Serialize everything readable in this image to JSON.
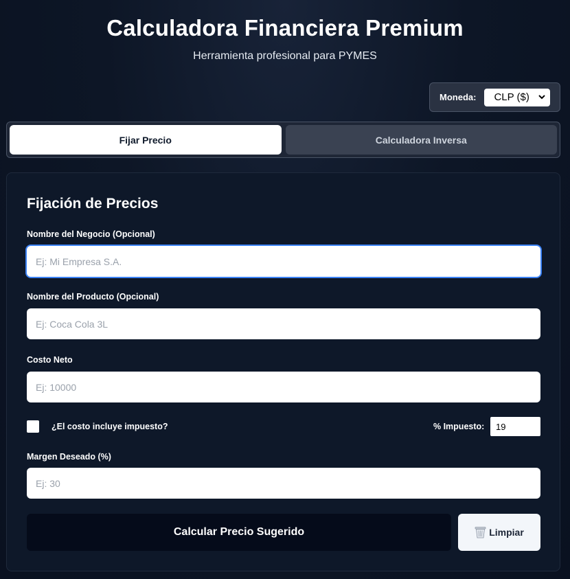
{
  "header": {
    "title": "Calculadora Financiera Premium",
    "subtitle": "Herramienta profesional para PYMES"
  },
  "currency": {
    "label": "Moneda:",
    "selected": "CLP ($)"
  },
  "tabs": [
    {
      "label": "Fijar Precio",
      "active": true
    },
    {
      "label": "Calculadora Inversa",
      "active": false
    }
  ],
  "form": {
    "title": "Fijación de Precios",
    "business_name": {
      "label": "Nombre del Negocio (Opcional)",
      "placeholder": "Ej: Mi Empresa S.A.",
      "value": ""
    },
    "product_name": {
      "label": "Nombre del Producto (Opcional)",
      "placeholder": "Ej: Coca Cola 3L",
      "value": ""
    },
    "net_cost": {
      "label": "Costo Neto",
      "placeholder": "Ej: 10000",
      "value": ""
    },
    "includes_tax": {
      "label": "¿El costo incluye impuesto?",
      "checked": false
    },
    "tax": {
      "label": "% Impuesto:",
      "value": "19"
    },
    "margin": {
      "label": "Margen Deseado (%)",
      "placeholder": "Ej: 30",
      "value": ""
    },
    "calculate_button": "Calcular Precio Sugerido",
    "clear_button": "Limpiar"
  },
  "icons": {
    "clear": "trash-icon",
    "select": "chevron-down-icon"
  }
}
